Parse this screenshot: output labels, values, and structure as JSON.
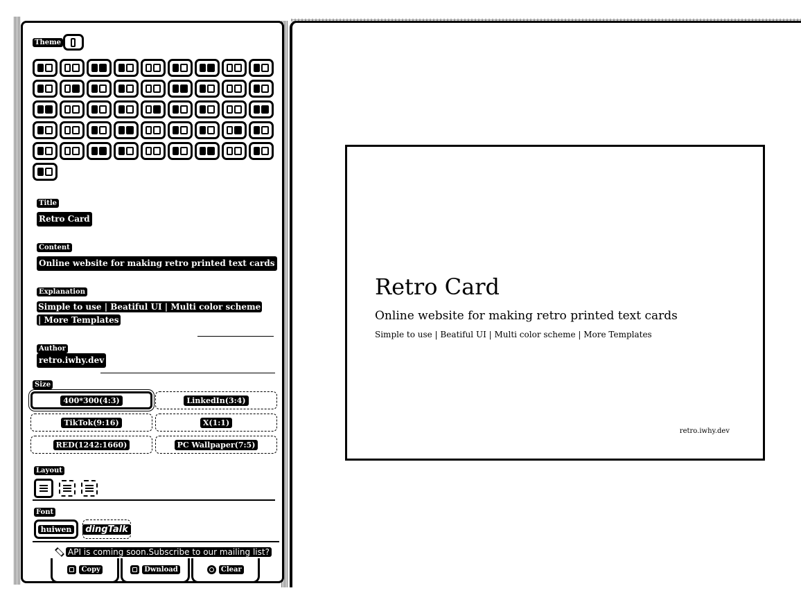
{
  "sidebar": {
    "theme_label": "Theme",
    "theme_swatch_count": 46,
    "title_label": "Title",
    "title_value": "Retro Card",
    "content_label": "Content",
    "content_value": "Online website for making retro printed text cards",
    "explanation_label": "Explanation",
    "explanation_value": "Simple to use | Beatiful UI | Multi color scheme | More Templates",
    "author_label": "Author",
    "author_value": "retro.iwhy.dev",
    "size_label": "Size",
    "sizes": [
      {
        "label": "400*300(4:3)",
        "active": true
      },
      {
        "label": "LinkedIn(3:4)",
        "active": false
      },
      {
        "label": "TikTok(9:16)",
        "active": false
      },
      {
        "label": "X(1:1)",
        "active": false
      },
      {
        "label": "RED(1242:1660)",
        "active": false
      },
      {
        "label": "PC Wallpaper(7:5)",
        "active": false
      }
    ],
    "layout_label": "Layout",
    "font_label": "Font",
    "fonts": [
      "huiwen",
      "dingTalk"
    ],
    "notice": "API is coming soon.Subscribe to our mailing list?",
    "actions": {
      "copy": "Copy",
      "download": "Dwnload",
      "clear": "Clear"
    }
  },
  "card": {
    "title": "Retro Card",
    "content": "Online website for making retro printed text cards",
    "explanation": "Simple to use | Beatiful UI | Multi color scheme | More Templates",
    "author": "retro.iwhy.dev"
  }
}
